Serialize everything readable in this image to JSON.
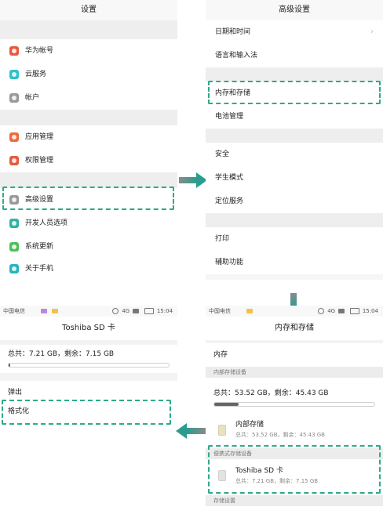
{
  "settings": {
    "title": "设置",
    "items": [
      {
        "label": "华为帐号",
        "icon": "huawei-account-icon",
        "color": "#e8593d"
      },
      {
        "label": "云服务",
        "icon": "cloud-icon",
        "color": "#2ec1c9"
      },
      {
        "label": "帐户",
        "icon": "account-icon",
        "color": "#9a9a9a"
      },
      {
        "label": "应用管理",
        "icon": "apps-icon",
        "color": "#ef6a3c"
      },
      {
        "label": "权限管理",
        "icon": "permissions-icon",
        "color": "#e8593d"
      },
      {
        "label": "高级设置",
        "icon": "advanced-gear-icon",
        "color": "#9a9a9a"
      },
      {
        "label": "开发人员选项",
        "icon": "developer-icon",
        "color": "#2fb3a4"
      },
      {
        "label": "系统更新",
        "icon": "system-update-icon",
        "color": "#4fbf5a"
      },
      {
        "label": "关于手机",
        "icon": "about-phone-icon",
        "color": "#27b5bf"
      }
    ]
  },
  "advanced": {
    "title": "高级设置",
    "items": [
      {
        "label": "日期和时间"
      },
      {
        "label": "语言和输入法"
      },
      {
        "label": "内存和存储"
      },
      {
        "label": "电池管理"
      },
      {
        "label": "安全"
      },
      {
        "label": "学生模式"
      },
      {
        "label": "定位服务"
      },
      {
        "label": "打印"
      },
      {
        "label": "辅助功能"
      }
    ]
  },
  "storage": {
    "status": {
      "carrier": "中国电信",
      "time": "15:04",
      "network": "4G"
    },
    "title": "内存和存储",
    "memory_label": "内存",
    "internal_section": "内部存储设备",
    "summary": "总共：53.52 GB，剩余：45.43 GB",
    "internal_usage": 0.15,
    "internal_name": "内部存储",
    "internal_detail": "总共：53.52 GB，剩余：45.43 GB",
    "portable_section": "便携式存储设备",
    "sd_name": "Toshiba SD 卡",
    "sd_detail": "总共：7.21 GB，剩余：7.15 GB",
    "more_section": "存储设置"
  },
  "sdcard": {
    "status": {
      "carrier": "中国电信",
      "time": "15:04",
      "network": "4G"
    },
    "title": "Toshiba SD 卡",
    "summary": "总共：7.21 GB，剩余：7.15 GB",
    "usage": 0.01,
    "eject": "弹出",
    "format": "格式化"
  },
  "colors": {
    "accent": "#2eaa8a",
    "arrow": "#2a9d8f"
  }
}
